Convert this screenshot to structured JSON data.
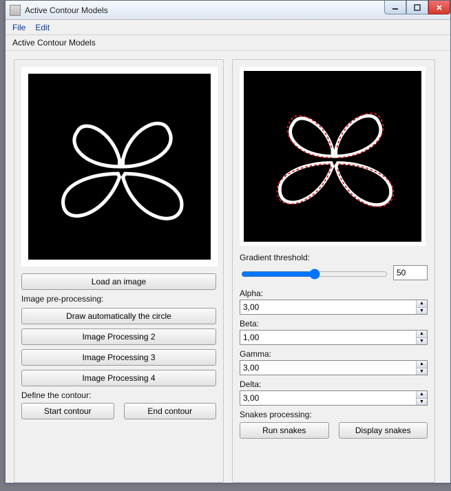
{
  "window": {
    "title": "Active Contour Models",
    "subtitle": "Active Contour Models"
  },
  "menu": {
    "file": "File",
    "edit": "Edit"
  },
  "left": {
    "load_btn": "Load an image",
    "preproc_label": "Image pre-processing:",
    "draw_circle_btn": "Draw automatically the circle",
    "proc2_btn": "Image Processing 2",
    "proc3_btn": "Image Processing 3",
    "proc4_btn": "Image Processing 4",
    "define_label": "Define the contour:",
    "start_btn": "Start contour",
    "end_btn": "End contour"
  },
  "right": {
    "grad_label": "Gradient threshold:",
    "grad_value": "50",
    "alpha_label": "Alpha:",
    "alpha_value": "3,00",
    "beta_label": "Beta:",
    "beta_value": "1,00",
    "gamma_label": "Gamma:",
    "gamma_value": "3,00",
    "delta_label": "Delta:",
    "delta_value": "3,00",
    "snakes_label": "Snakes processing:",
    "run_btn": "Run snakes",
    "display_btn": "Display snakes"
  }
}
